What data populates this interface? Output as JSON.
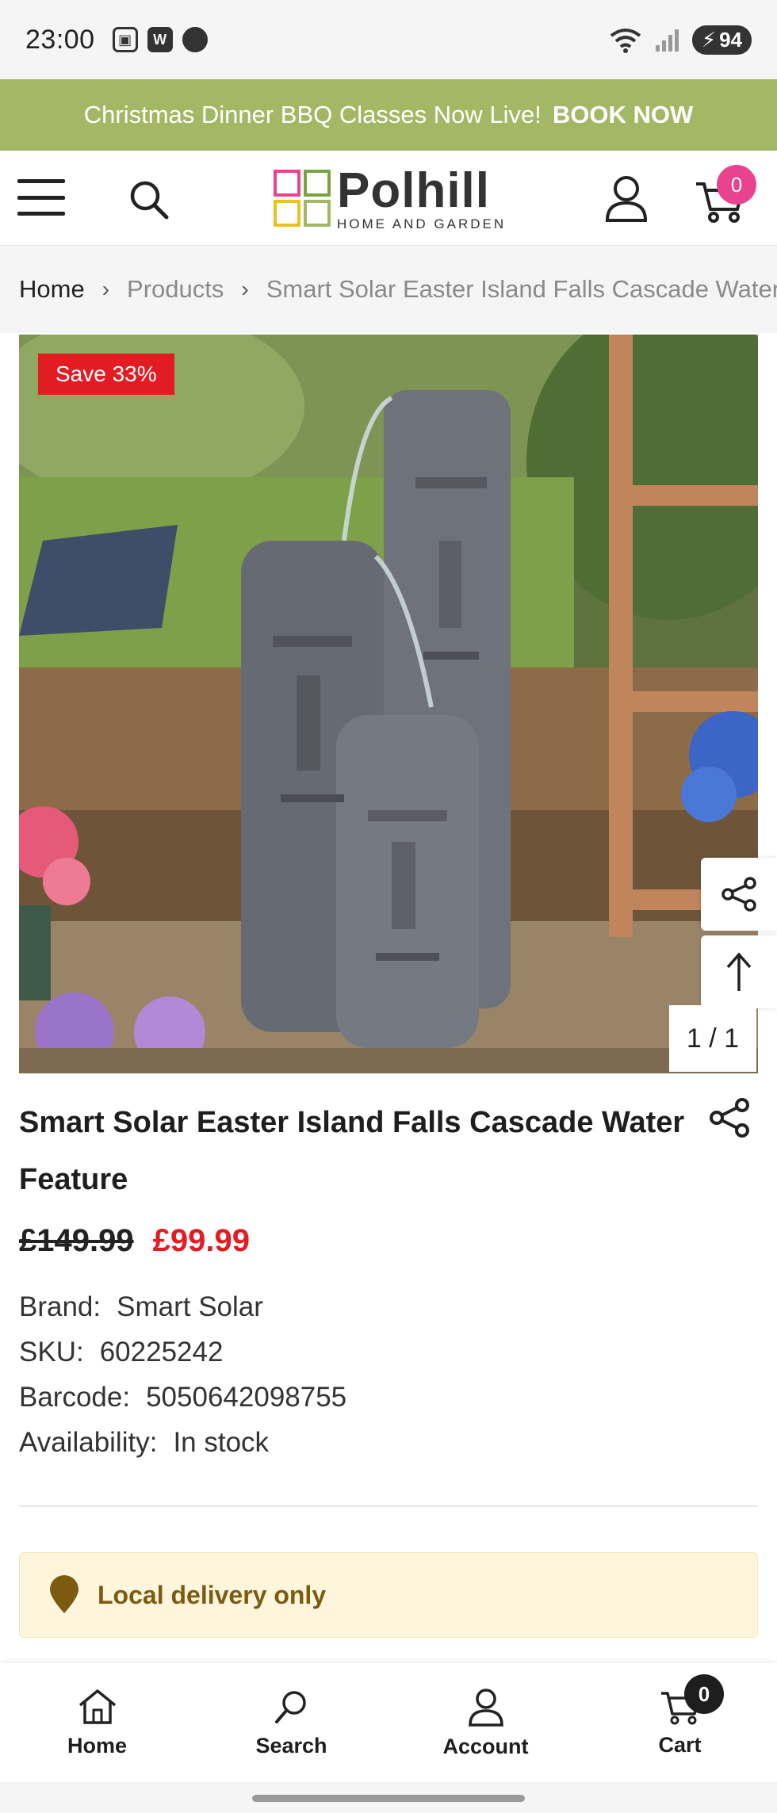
{
  "status_bar": {
    "time": "23:00",
    "left_icons": [
      "screenshot-icon",
      "w-app-icon",
      "messenger-icon"
    ],
    "wifi_label": "5",
    "battery": "94"
  },
  "promo": {
    "text": "Christmas Dinner BBQ Classes Now Live!",
    "cta": "BOOK NOW"
  },
  "header": {
    "logo_name": "Polhill",
    "logo_sub": "HOME AND GARDEN",
    "cart_count": "0"
  },
  "breadcrumb": {
    "home": "Home",
    "products": "Products",
    "current": "Smart Solar Easter Island Falls Cascade Water Feature"
  },
  "gallery": {
    "badge": "Save 33%",
    "counter": "1 / 1"
  },
  "product": {
    "title": "Smart Solar Easter Island Falls Cascade Water Feature",
    "old_price": "£149.99",
    "new_price": "£99.99",
    "meta": [
      {
        "label": "Brand:",
        "value": "Smart Solar"
      },
      {
        "label": "SKU:",
        "value": "60225242"
      },
      {
        "label": "Barcode:",
        "value": "5050642098755"
      },
      {
        "label": "Availability:",
        "value": "In stock"
      }
    ],
    "delivery_note": "Local delivery only"
  },
  "bottom_nav": {
    "items": [
      {
        "label": "Home",
        "icon": "home-icon"
      },
      {
        "label": "Search",
        "icon": "search-icon"
      },
      {
        "label": "Account",
        "icon": "account-icon"
      },
      {
        "label": "Cart",
        "icon": "cart-icon"
      }
    ],
    "cart_badge": "0"
  },
  "colors": {
    "promo_bg": "#a2b864",
    "sale_red": "#e31b23",
    "cart_badge_pink": "#e9428f",
    "delivery_bg": "#fdf6dd",
    "delivery_text": "#7c5b11"
  }
}
